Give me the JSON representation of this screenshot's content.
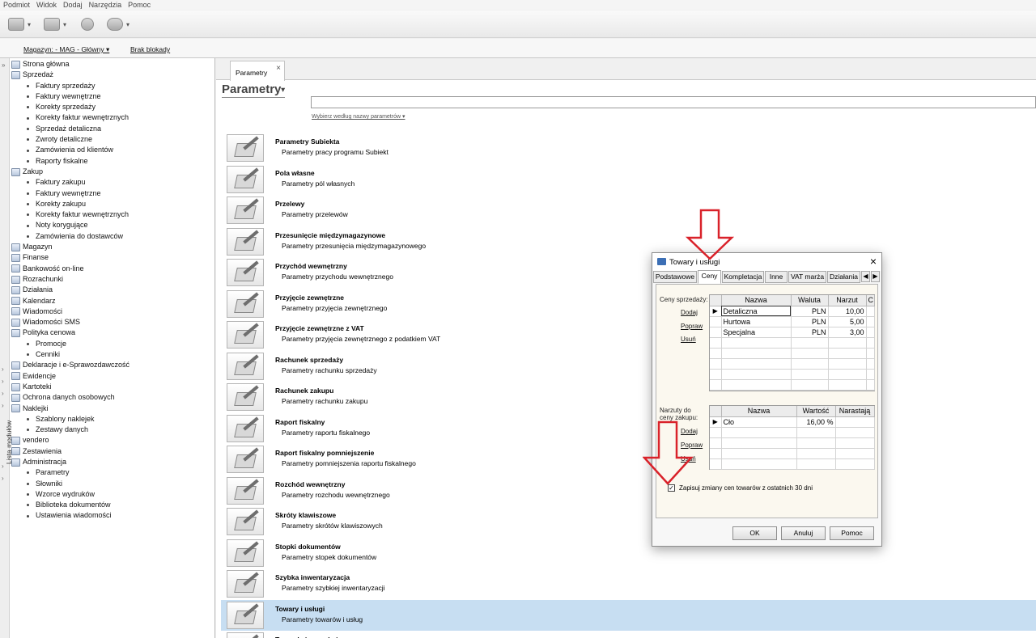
{
  "menu": [
    "Podmiot",
    "Widok",
    "Dodaj",
    "Narzędzia",
    "Pomoc"
  ],
  "toolbar": {
    "icons": [
      "mail-icon",
      "folder-icon",
      "coins-icon",
      "help-icon"
    ]
  },
  "statusbar": {
    "warehouse": "Magazyn: - MAG - Główny ▾",
    "lock": "Brak blokady"
  },
  "sidebar": {
    "strip_label": "Lista modułów",
    "items": [
      {
        "label": "Strona główna",
        "level": 0
      },
      {
        "label": "Sprzedaż",
        "level": 0
      },
      {
        "label": "Faktury sprzedaży",
        "level": 1
      },
      {
        "label": "Faktury wewnętrzne",
        "level": 1
      },
      {
        "label": "Korekty sprzedaży",
        "level": 1
      },
      {
        "label": "Korekty faktur wewnętrznych",
        "level": 1
      },
      {
        "label": "Sprzedaż detaliczna",
        "level": 1
      },
      {
        "label": "Zwroty detaliczne",
        "level": 1
      },
      {
        "label": "Zamówienia od klientów",
        "level": 1
      },
      {
        "label": "Raporty fiskalne",
        "level": 1
      },
      {
        "label": "Zakup",
        "level": 0
      },
      {
        "label": "Faktury zakupu",
        "level": 1
      },
      {
        "label": "Faktury wewnętrzne",
        "level": 1
      },
      {
        "label": "Korekty zakupu",
        "level": 1
      },
      {
        "label": "Korekty faktur wewnętrznych",
        "level": 1
      },
      {
        "label": "Noty korygujące",
        "level": 1
      },
      {
        "label": "Zamówienia do dostawców",
        "level": 1
      },
      {
        "label": "Magazyn",
        "level": 0
      },
      {
        "label": "Finanse",
        "level": 0
      },
      {
        "label": "Bankowość on-line",
        "level": 0
      },
      {
        "label": "Rozrachunki",
        "level": 0
      },
      {
        "label": "Działania",
        "level": 0
      },
      {
        "label": "Kalendarz",
        "level": 0
      },
      {
        "label": "Wiadomości",
        "level": 0
      },
      {
        "label": "Wiadomości SMS",
        "level": 0
      },
      {
        "label": "Polityka cenowa",
        "level": 0
      },
      {
        "label": "Promocje",
        "level": 1
      },
      {
        "label": "Cenniki",
        "level": 1
      },
      {
        "label": "Deklaracje i e-Sprawozdawczość",
        "level": 0
      },
      {
        "label": "Ewidencje",
        "level": 0
      },
      {
        "label": "Kartoteki",
        "level": 0
      },
      {
        "label": "Ochrona danych osobowych",
        "level": 0
      },
      {
        "label": "Naklejki",
        "level": 0
      },
      {
        "label": "Szablony naklejek",
        "level": 1
      },
      {
        "label": "Zestawy danych",
        "level": 1
      },
      {
        "label": "vendero",
        "level": 0
      },
      {
        "label": "Zestawienia",
        "level": 0
      },
      {
        "label": "Administracja",
        "level": 0
      },
      {
        "label": "Parametry",
        "level": 1
      },
      {
        "label": "Słowniki",
        "level": 1
      },
      {
        "label": "Wzorce wydruków",
        "level": 1
      },
      {
        "label": "Biblioteka dokumentów",
        "level": 1
      },
      {
        "label": "Ustawienia wiadomości",
        "level": 1
      }
    ]
  },
  "main": {
    "tab_label": "Parametry",
    "title": "Parametry",
    "search_hint": "Wybierz według nazwy parametrów ▾",
    "params": [
      {
        "title": "Parametry Subiekta",
        "desc": "Parametry pracy programu Subiekt"
      },
      {
        "title": "Pola własne",
        "desc": "Parametry pól własnych"
      },
      {
        "title": "Przelewy",
        "desc": "Parametry przelewów"
      },
      {
        "title": "Przesunięcie międzymagazynowe",
        "desc": "Parametry przesunięcia międzymagazynowego"
      },
      {
        "title": "Przychód wewnętrzny",
        "desc": "Parametry przychodu wewnętrznego"
      },
      {
        "title": "Przyjęcie zewnętrzne",
        "desc": "Parametry przyjęcia zewnętrznego"
      },
      {
        "title": "Przyjęcie zewnętrzne z VAT",
        "desc": "Parametry przyjęcia zewnętrznego z podatkiem VAT"
      },
      {
        "title": "Rachunek sprzedaży",
        "desc": "Parametry rachunku sprzedaży"
      },
      {
        "title": "Rachunek zakupu",
        "desc": "Parametry rachunku zakupu"
      },
      {
        "title": "Raport fiskalny",
        "desc": "Parametry raportu fiskalnego"
      },
      {
        "title": "Raport fiskalny pomniejszenie",
        "desc": "Parametry pomniejszenia raportu fiskalnego"
      },
      {
        "title": "Rozchód wewnętrzny",
        "desc": "Parametry rozchodu wewnętrznego"
      },
      {
        "title": "Skróty klawiszowe",
        "desc": "Parametry skrótów klawiszowych"
      },
      {
        "title": "Stopki dokumentów",
        "desc": "Parametry stopek dokumentów"
      },
      {
        "title": "Szybka inwentaryzacja",
        "desc": "Parametry szybkiej inwentaryzacji"
      },
      {
        "title": "Towary i usługi",
        "desc": "Parametry towarów i usług",
        "selected": true
      },
      {
        "title": "Transakcja oczekująca",
        "desc": ""
      }
    ]
  },
  "dialog": {
    "title": "Towary i usługi",
    "tabs": [
      "Podstawowe",
      "Ceny",
      "Kompletacja",
      "Inne",
      "VAT marża",
      "Działania"
    ],
    "active_tab": "Ceny",
    "prices": {
      "label": "Ceny sprzedaży:",
      "actions": [
        "Dodaj",
        "Popraw",
        "Usuń"
      ],
      "columns": [
        "Nazwa",
        "Waluta",
        "Narzut",
        "C"
      ],
      "rows": [
        {
          "name": "Detaliczna",
          "currency": "PLN",
          "markup": "10,00"
        },
        {
          "name": "Hurtowa",
          "currency": "PLN",
          "markup": "5,00"
        },
        {
          "name": "Specjalna",
          "currency": "PLN",
          "markup": "3,00"
        }
      ]
    },
    "markups": {
      "label_line1": "Narzuty do",
      "label_line2": "ceny zakupu:",
      "actions": [
        "Dodaj",
        "Popraw",
        "Usuń"
      ],
      "columns": [
        "Nazwa",
        "Wartość",
        "Narastają"
      ],
      "rows": [
        {
          "name": "Cło",
          "value": "16,00 %",
          "cumulative": ""
        }
      ]
    },
    "checkbox_label": "Zapisuj zmiany cen towarów z ostatnich 30 dni",
    "checkbox_checked": true,
    "buttons": {
      "ok": "OK",
      "cancel": "Anuluj",
      "help": "Pomoc"
    }
  },
  "colors": {
    "selection": "#c7def2",
    "arrow": "#d9222a"
  }
}
